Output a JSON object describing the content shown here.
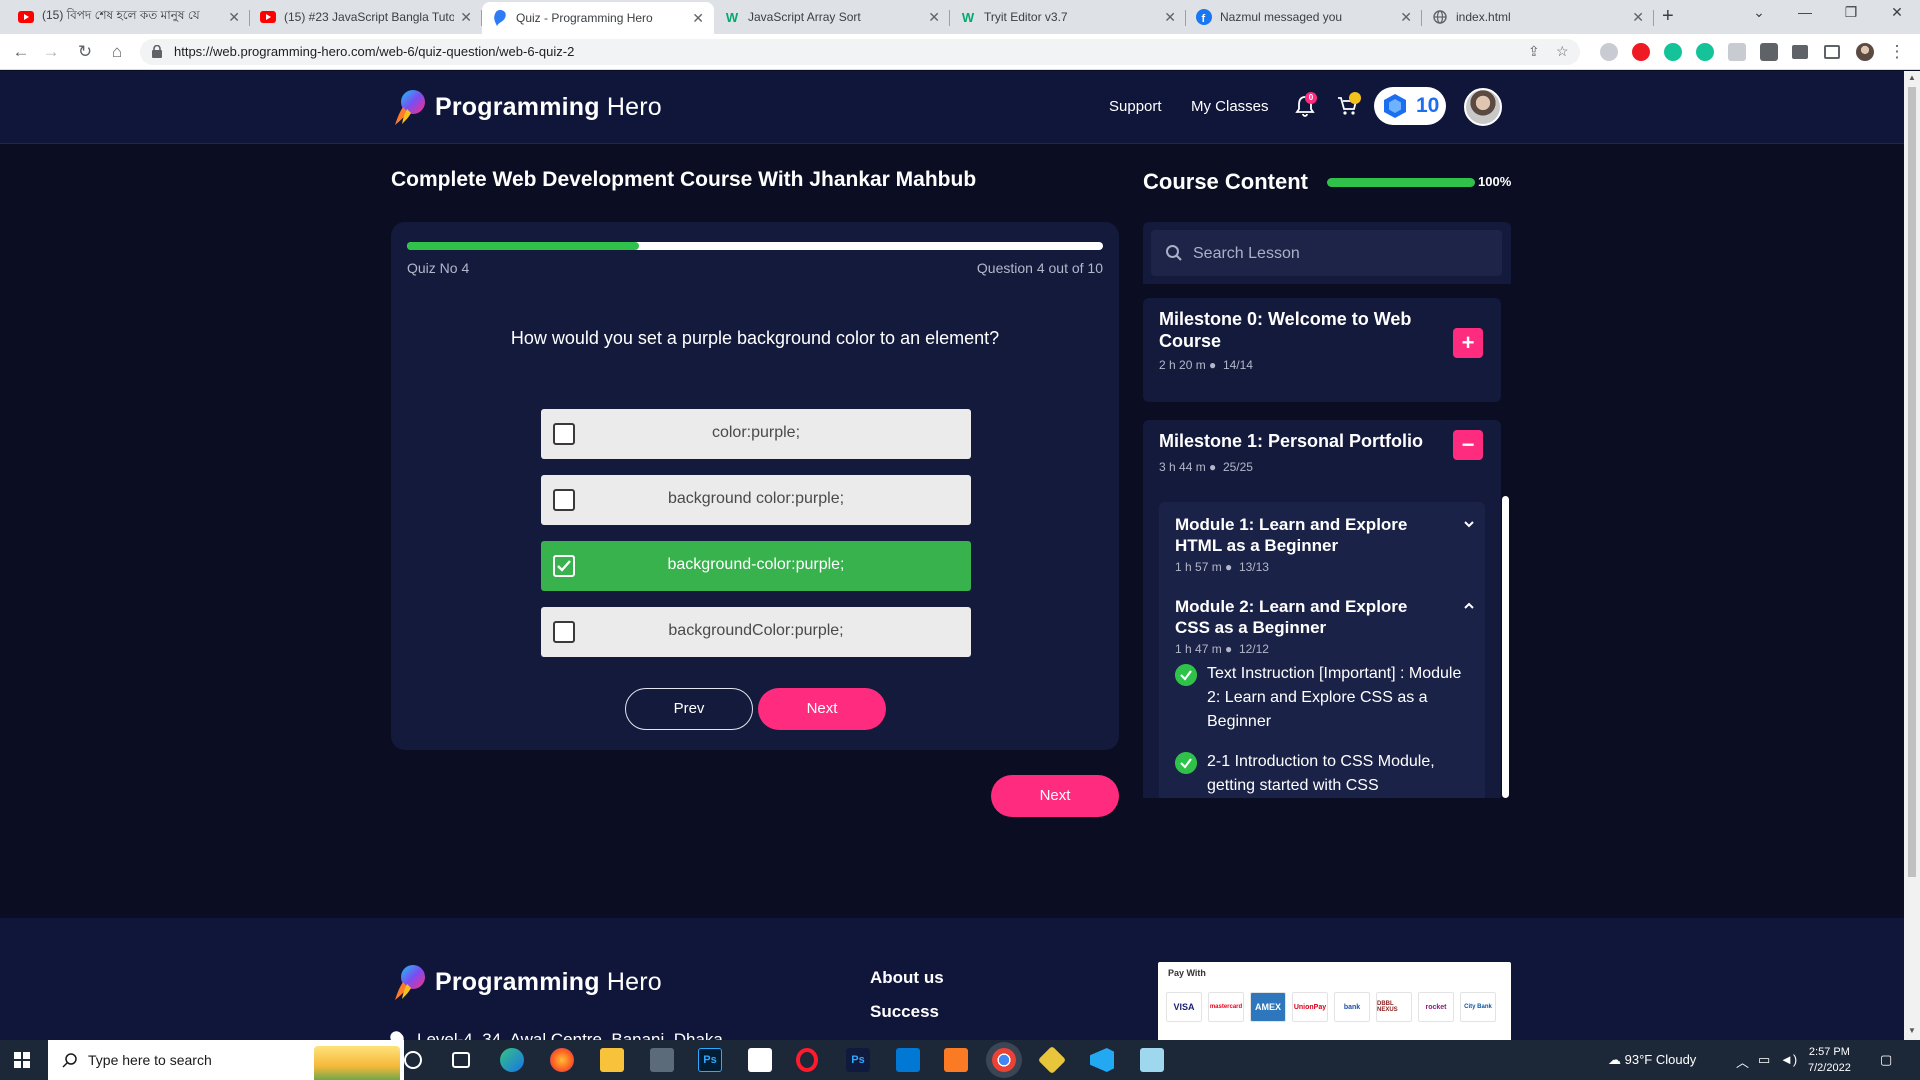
{
  "browser": {
    "tabs": [
      {
        "title": "(15) বিপদ শেষ হলে কত মানুষ যে",
        "icon": "youtube-icon"
      },
      {
        "title": "(15) #23 JavaScript Bangla Tuto",
        "icon": "youtube-icon"
      },
      {
        "title": "Quiz - Programming Hero",
        "icon": "programming-hero-icon",
        "active": true
      },
      {
        "title": "JavaScript Array Sort",
        "icon": "w3schools-icon"
      },
      {
        "title": "Tryit Editor v3.7",
        "icon": "w3schools-icon"
      },
      {
        "title": "Nazmul messaged you",
        "icon": "facebook-icon"
      },
      {
        "title": "index.html",
        "icon": "globe-icon"
      }
    ],
    "url": "https://web.programming-hero.com/web-6/quiz-question/web-6-quiz-2"
  },
  "header": {
    "brand_bold": "Programming",
    "brand_light": "Hero",
    "nav": [
      "Support",
      "My Classes"
    ],
    "notification_count": "0",
    "gems": "10"
  },
  "quiz": {
    "course_title": "Complete Web Development Course With Jhankar Mahbub",
    "progress_fraction": 0.333,
    "quiz_no": "Quiz No 4",
    "question_count": "Question 4 out of 10",
    "question": "How would you set a purple background color to an element?",
    "options": [
      {
        "text": "color:purple;",
        "selected": false
      },
      {
        "text": "background color:purple;",
        "selected": false
      },
      {
        "text": "background-color:purple;",
        "selected": true
      },
      {
        "text": "backgroundColor:purple;",
        "selected": false
      }
    ],
    "prev_label": "Prev",
    "next_label": "Next",
    "outer_next_label": "Next"
  },
  "sidebar": {
    "title": "Course Content",
    "progress_fraction": 1.0,
    "progress_text": "100%",
    "search_placeholder": "Search Lesson",
    "milestones": [
      {
        "title": "Milestone 0: Welcome to Web Course",
        "duration": "2 h 20 m",
        "count": "14/14",
        "expanded": false
      },
      {
        "title": "Milestone 1: Personal Portfolio",
        "duration": "3 h 44 m",
        "count": "25/25",
        "expanded": true
      }
    ],
    "modules": [
      {
        "title": "Module 1: Learn and Explore HTML as a Beginner",
        "duration": "1 h 57 m",
        "count": "13/13",
        "expanded": false
      },
      {
        "title": "Module 2: Learn and Explore CSS as a Beginner",
        "duration": "1 h 47 m",
        "count": "12/12",
        "expanded": true
      }
    ],
    "lessons": [
      "Text Instruction [Important] : Module 2: Learn and Explore CSS as a Beginner",
      "2-1 Introduction to CSS Module, getting started with CSS"
    ]
  },
  "footer": {
    "brand_bold": "Programming",
    "brand_light": "Hero",
    "links": [
      "About us",
      "Success"
    ],
    "address": "Level-4, 34, Awal Centre, Banani, Dhaka",
    "pay_with": "Pay With",
    "pay_cards": [
      "VISA",
      "mastercard",
      "AMEX",
      "UnionPay",
      "bank",
      "DBBL NEXUS",
      "rocket",
      "City Bank"
    ]
  },
  "taskbar": {
    "search_placeholder": "Type here to search",
    "weather": "93°F  Cloudy",
    "time": "2:57 PM",
    "date": "7/2/2022"
  },
  "colors": {
    "accent": "#ff2b7f",
    "success": "#2fc149",
    "page_bg": "#0b0e22",
    "card_bg": "#141a3c"
  }
}
